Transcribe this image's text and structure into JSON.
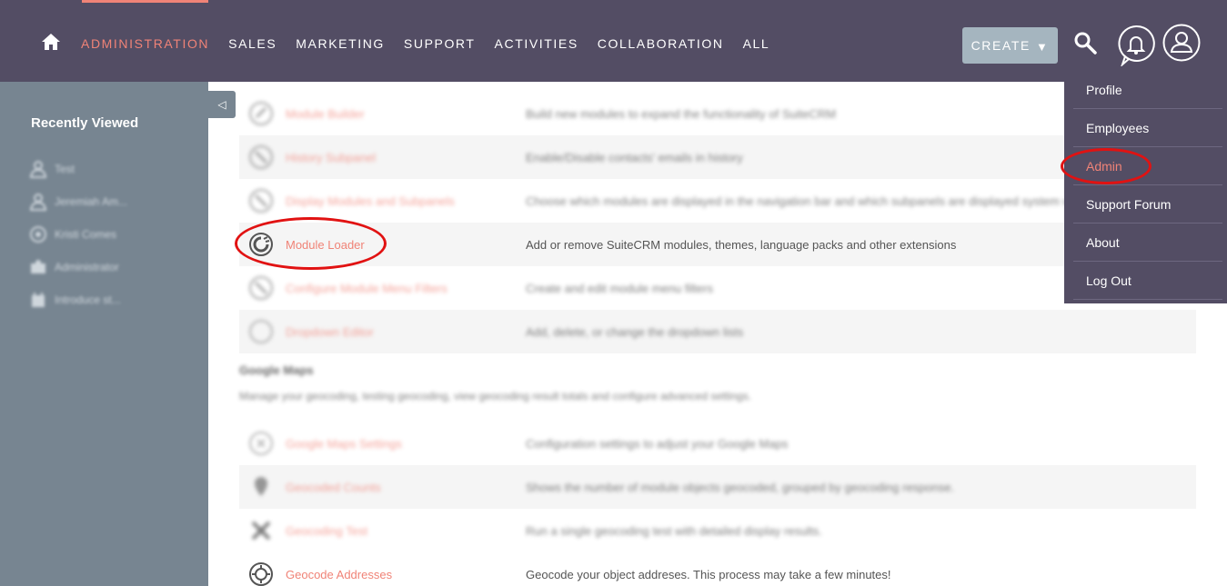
{
  "topnav": {
    "home_icon": "home-icon",
    "items": [
      "ADMINISTRATION",
      "SALES",
      "MARKETING",
      "SUPPORT",
      "ACTIVITIES",
      "COLLABORATION",
      "ALL"
    ],
    "active": "ADMINISTRATION",
    "create_label": "CREATE",
    "accent_color": "#f08377",
    "bar_color": "#534d64"
  },
  "sidebar": {
    "title": "Recently Viewed",
    "items": [
      "Test",
      "Jeremiah Am...",
      "Kristi Comes",
      "Administrator",
      "Introduce st..."
    ],
    "collapse_glyph": "◁"
  },
  "main": {
    "rows_top": [
      {
        "label": "Module Builder",
        "desc": "Build new modules to expand the functionality of SuiteCRM",
        "icon": "module-builder-icon"
      },
      {
        "label": "History Subpanel",
        "desc": "Enable/Disable contacts' emails in history",
        "icon": "history-icon"
      },
      {
        "label": "Display Modules and Subpanels",
        "desc": "Choose which modules are displayed in the navigation bar and which subpanels are displayed system wide",
        "icon": "display-modules-icon"
      },
      {
        "label": "Module Loader",
        "desc": "Add or remove SuiteCRM modules, themes, language packs and other extensions",
        "icon": "module-loader-icon"
      },
      {
        "label": "Configure Module Menu Filters",
        "desc": "Create and edit module menu filters",
        "icon": "menu-filters-icon"
      },
      {
        "label": "Dropdown Editor",
        "desc": "Add, delete, or change the dropdown lists",
        "icon": "dropdown-editor-icon"
      }
    ],
    "section": {
      "title": "Google Maps",
      "desc": "Manage your geocoding, testing geocoding, view geocoding result totals and configure advanced settings."
    },
    "rows_maps": [
      {
        "label": "Google Maps Settings",
        "desc": "Configuration settings to adjust your Google Maps",
        "icon": "maps-settings-icon"
      },
      {
        "label": "Geocoded Counts",
        "desc": "Shows the number of module objects geocoded, grouped by geocoding response.",
        "icon": "geocoded-counts-icon"
      },
      {
        "label": "Geocoding Test",
        "desc": "Run a single geocoding test with detailed display results.",
        "icon": "geocoding-test-icon"
      },
      {
        "label": "Geocode Addresses",
        "desc": "Geocode your object addreses. This process may take a few minutes!",
        "icon": "geocode-addresses-icon"
      }
    ]
  },
  "user_menu": {
    "items": [
      "Profile",
      "Employees",
      "Admin",
      "Support Forum",
      "About",
      "Log Out"
    ],
    "highlighted": "Admin"
  }
}
